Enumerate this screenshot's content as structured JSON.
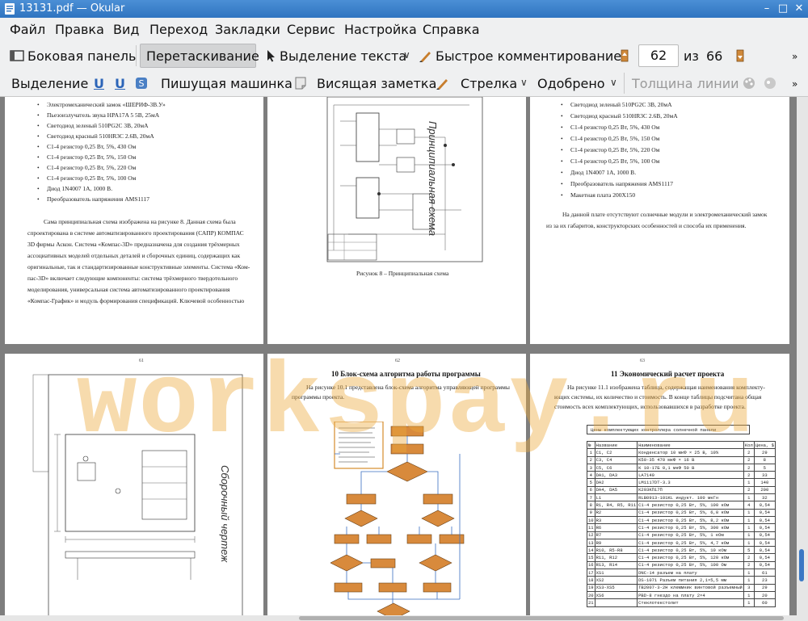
{
  "window": {
    "title": "13131.pdf — Okular"
  },
  "menu": [
    "Файл",
    "Правка",
    "Вид",
    "Переход",
    "Закладки",
    "Сервис",
    "Настройка",
    "Справка"
  ],
  "toolbar1": {
    "sidebar": "Боковая панель",
    "drag": "Перетаскивание",
    "text_select": "Выделение текста",
    "quick_comment": "Быстрое комментирование",
    "page_current": "62",
    "page_of": "из",
    "page_total": "66"
  },
  "toolbar2": {
    "selection": "Выделение",
    "typewriter": "Пишущая машинка",
    "sticky_note": "Висящая заметка",
    "arrow": "Стрелка",
    "approved": "Одобрено",
    "line_width": "Толщина линии"
  },
  "watermark": "workspay.ru",
  "pages": {
    "p1": {
      "bullets": [
        "Электромеханический замок «ШЕРИФ-3В.У»",
        "Пьезоизлучатель звука HPA17A 5 5В, 25мА",
        "Светодиод  зеленый 510PG2C  3В, 20мА",
        "Светодиод  красный  510HR3C  2.6В, 20мА",
        "С1-4 резистор 0,25 Вт, 5%, 430 Ом",
        "С1-4 резистор 0,25 Вт, 5%, 150 Ом",
        "С1-4 резистор 0,25 Вт, 5%, 220 Ом",
        "С1-4 резистор 0,25 Вт, 5%, 100 Ом",
        "Диод 1N4007  1А, 1000 В.",
        "Преобразователь напряжения  AMS1117"
      ],
      "paragraph": [
        "Сама принципиальная схема изображена на рисунке 8. Данная схема была",
        "спроектирована в системе автоматизированного проектирования (САПР) КОМПАС",
        "3D фирмы Аскон. Система «Компас-3D» предназначена для создания трёхмерных",
        "ассоциативных моделей отдельных деталей и сборочных единиц, содержащих как",
        "оригинальные, так и стандартизированные конструктивные элементы. Система «Ком-",
        "пас-3D» включает следующие компоненты: система трёхмерного твердотельного",
        "моделирования, универсальная система автоматизированного проектирования",
        "«Компас-График» и модуль формирования спецификаций. Ключевой особенностью"
      ]
    },
    "p2": {
      "caption": "Рисунок 8 – Принципиальная схема",
      "vertical_label": "Принципиальная схема"
    },
    "p3": {
      "bullets": [
        "Светодиод  зеленый 510PG2C  3В, 20мА",
        "Светодиод  красный  510HR3C  2.6В, 20мА",
        "С1-4 резистор 0,25 Вт, 5%, 430 Ом",
        "С1-4 резистор 0,25 Вт, 5%, 150 Ом",
        "С1-4 резистор 0,25 Вт, 5%, 220 Ом",
        "С1-4 резистор 0,25 Вт, 5%, 100 Ом",
        "Диод 1N4007  1А, 1000 В.",
        "Преобразователь напряжения  AMS1117",
        "Макетная плата 200Х150"
      ],
      "paragraph": [
        "На данной плате отсутствуют солнечные модули и электромеханический замок",
        "из за их габаритов, конструкторских особенностей и способа их применения."
      ]
    },
    "p4": {
      "number": "61",
      "vertical_label": "Сборочный чертеж"
    },
    "p5": {
      "number": "62",
      "title": "10 Блок-схема алгоритма работы программы",
      "paragraph": [
        "На рисунке 10.1 представлена блок-схема алгоритма управляющей  программы",
        "программы проекта."
      ]
    },
    "p6": {
      "number": "63",
      "title": "11 Экономический  расчет проекта",
      "paragraph": [
        "На рисунке 11.1 изображена таблица, содержащая наименования комплекту-",
        "ющих системы, их количество и стоимость.  В конце таблицы подсчитана общая",
        "стоимость всех комплектующих, использовавшихся в разработке проекта."
      ],
      "table_title": "Цены комплектующих контроллера солнечной панели",
      "table_header": [
        "№",
        "Название",
        "Наименование",
        "Кол",
        "Цена, $"
      ],
      "table_rows": [
        [
          "1",
          "C1, C2",
          "Конденсатор 10 мкФ × 25 В, 10%",
          "2",
          "29"
        ],
        [
          "2",
          "C3, C4",
          "K50-35 470 мкФ × 16 В",
          "2",
          "8"
        ],
        [
          "3",
          "C5, C6",
          "K 10-17Б 0,1 мкФ 50 В",
          "2",
          "5"
        ],
        [
          "4",
          "DA1, DA3",
          "LA7140",
          "2",
          "33"
        ],
        [
          "5",
          "DA2",
          "LM1117DT-3.3",
          "1",
          "140"
        ],
        [
          "6",
          "DA4, DA5",
          "K293KП17П",
          "2",
          "200"
        ],
        [
          "7",
          "L1",
          "RLB0913-101KL индукт. 100 мкГн",
          "1",
          "32"
        ],
        [
          "8",
          "R1, R4, R5, R11",
          "С1-4 резистор 0,25 Вт, 5%, 100 кОм",
          "4",
          "0,54"
        ],
        [
          "9",
          "R2",
          "С1-4 резистор 0,25 Вт, 5%, 6,8 кОм",
          "1",
          "0,54"
        ],
        [
          "10",
          "R3",
          "С1-4 резистор 0,25 Вт, 5%, 8,2 кОм",
          "1",
          "0,54"
        ],
        [
          "11",
          "R6",
          "С1-4 резистор 0,25 Вт, 5%, 300 кОм",
          "1",
          "0,54"
        ],
        [
          "12",
          "R7",
          "С1-4 резистор 0,25 Вт, 5%, 1 кОм",
          "1",
          "0,54"
        ],
        [
          "13",
          "R9",
          "С1-4 резистор 0,25 Вт, 5%, 4,7 кОм",
          "1",
          "0,54"
        ],
        [
          "14",
          "R10, R5-R8",
          "С1-4 резистор 0,25 Вт, 5%, 10 кОм",
          "5",
          "0,54"
        ],
        [
          "15",
          "R11, R12",
          "С1-4 резистор 0,25 Вт, 5%, 120 кОм",
          "2",
          "0,54"
        ],
        [
          "16",
          "R13, R14",
          "С1-4 резистор 0,25 Вт, 5%, 100 Ом",
          "2",
          "0,54"
        ],
        [
          "17",
          "XS1",
          "DNC-14 разъем на плату",
          "1",
          "61"
        ],
        [
          "18",
          "XS2",
          "DS-1071 Разъем питания 2,1×5,5 мм",
          "1",
          "23"
        ],
        [
          "19",
          "XS3-XS5",
          "TB2007-3-2H клеммник винтовой разъемный",
          "3",
          "29"
        ],
        [
          "20",
          "XS6",
          "PBD-8 гнездо на плату 2×4",
          "1",
          "20"
        ],
        [
          "21",
          "",
          "Стеклотекстолит",
          "1",
          "60"
        ]
      ]
    }
  }
}
